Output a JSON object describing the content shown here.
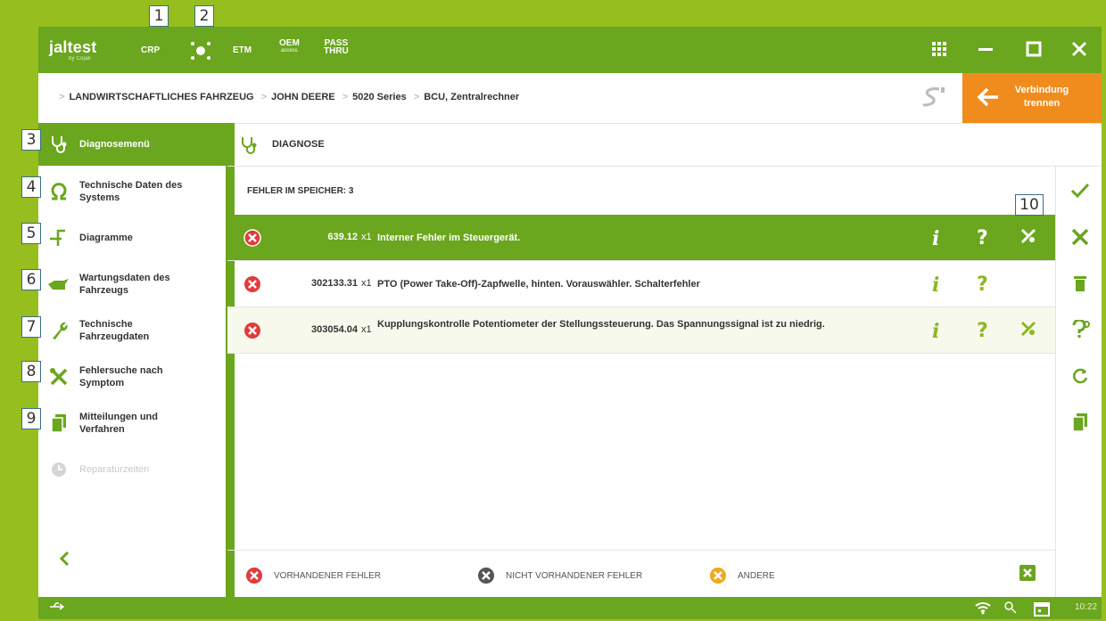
{
  "callouts": [
    "1",
    "2",
    "3",
    "4",
    "5",
    "6",
    "7",
    "8",
    "9",
    "10"
  ],
  "titlebar": {
    "logo": "jaltest",
    "logo_sub": "by Cojali",
    "tools": {
      "crp": "CRP",
      "etm": "ETM",
      "oem_top": "OEM",
      "oem_bottom": "access",
      "pass_top": "PASS",
      "pass_bottom": "THRU"
    }
  },
  "breadcrumb": {
    "items": [
      "LANDWIRTSCHAFTLICHES FAHRZEUG",
      "JOHN DEERE",
      "5020 Series",
      "BCU, Zentralrechner"
    ]
  },
  "disconnect": {
    "line1": "Verbindung",
    "line2": "trennen"
  },
  "sidebar": {
    "items": [
      {
        "label": "Diagnosemenü",
        "icon": "stethoscope-icon"
      },
      {
        "label": "Technische Daten des Systems",
        "icon": "omega-icon"
      },
      {
        "label": "Diagramme",
        "icon": "diagram-icon"
      },
      {
        "label": "Wartungsdaten des Fahrzeugs",
        "icon": "oilcan-icon"
      },
      {
        "label": "Technische Fahrzeugdaten",
        "icon": "wrench-icon"
      },
      {
        "label": "Fehlersuche nach Symptom",
        "icon": "tools-icon"
      },
      {
        "label": "Mitteilungen und Verfahren",
        "icon": "documents-icon"
      },
      {
        "label": "Reparaturzeiten",
        "icon": "clock-gear-icon"
      }
    ]
  },
  "main": {
    "title": "DIAGNOSE",
    "error_count_label": "FEHLER IM SPEICHER: 3",
    "errors": [
      {
        "code": "639.12",
        "count": "x1",
        "desc": "Interner Fehler im Steuergerät.",
        "tools": true
      },
      {
        "code": "302133.31",
        "count": "x1",
        "desc": "PTO (Power Take-Off)-Zapfwelle, hinten. Vorauswähler. Schalterfehler",
        "tools": false
      },
      {
        "code": "303054.04",
        "count": "x1",
        "desc": "Kupplungskontrolle Potentiometer der Stellungssteuerung. Das Spannungssignal ist zu niedrig.",
        "tools": true
      }
    ],
    "info_symbol": "i",
    "help_symbol": "?",
    "legend": {
      "present": "VORHANDENER FEHLER",
      "not_present": "NICHT VORHANDENER FEHLER",
      "other": "ANDERE"
    }
  },
  "status": {
    "time": "10:22"
  },
  "colors": {
    "green": "#6aa61e",
    "orange": "#f08c1e",
    "red": "#e03c3c",
    "lime": "#96be1e"
  }
}
